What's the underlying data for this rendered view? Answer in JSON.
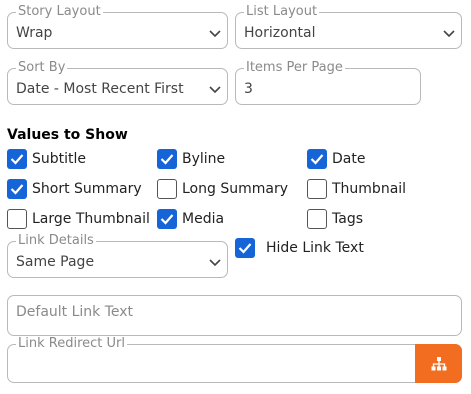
{
  "story_layout": {
    "label": "Story Layout",
    "value": "Wrap"
  },
  "list_layout": {
    "label": "List Layout",
    "value": "Horizontal"
  },
  "sort_by": {
    "label": "Sort By",
    "value": "Date - Most Recent First"
  },
  "items_per_page": {
    "label": "Items Per Page",
    "value": "3"
  },
  "values_section": {
    "title": "Values to Show",
    "items": [
      {
        "label": "Subtitle",
        "checked": true
      },
      {
        "label": "Byline",
        "checked": true
      },
      {
        "label": "Date",
        "checked": true
      },
      {
        "label": "Short Summary",
        "checked": true
      },
      {
        "label": "Long Summary",
        "checked": false
      },
      {
        "label": "Thumbnail",
        "checked": false
      },
      {
        "label": "Large Thumbnail",
        "checked": false
      },
      {
        "label": "Media",
        "checked": true
      },
      {
        "label": "Tags",
        "checked": false
      }
    ]
  },
  "link_details": {
    "label": "Link Details",
    "value": "Same Page"
  },
  "hide_link_text": {
    "label": "Hide Link Text",
    "checked": true
  },
  "default_link_text": {
    "placeholder": "Default Link Text"
  },
  "link_redirect_url": {
    "label": "Link Redirect Url",
    "value": "",
    "button_icon": "sitemap-icon"
  },
  "colors": {
    "accent": "#1565d8",
    "button": "#f36d21"
  }
}
